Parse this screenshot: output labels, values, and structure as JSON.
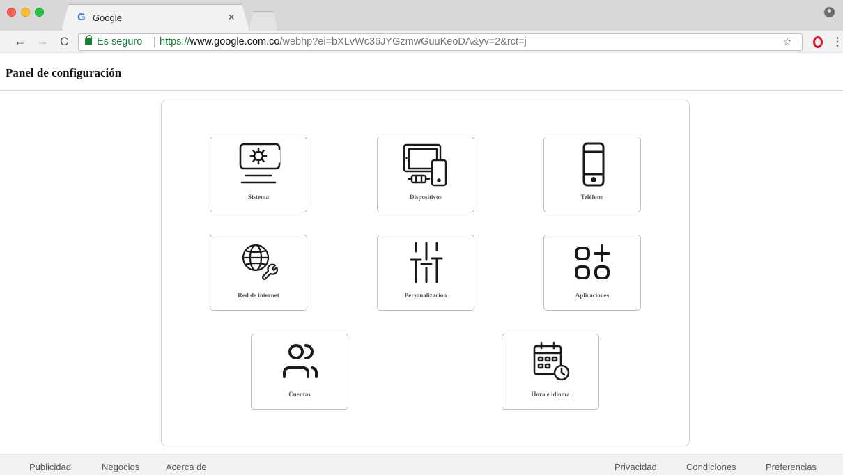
{
  "browser": {
    "tab_title": "Google",
    "tab_favicon": "G",
    "tab_close": "×",
    "secure_label": "Es seguro",
    "url_scheme": "https://",
    "url_host": "www.google.com.co",
    "url_rest": "/webhp?ei=bXLvWc36JYGzmwGuuKeoDA&yv=2&rct=j",
    "nav_back": "←",
    "nav_forward": "→",
    "nav_reload": "C",
    "bookmark_star": "☆",
    "menu": "⋮"
  },
  "page": {
    "title": "Panel de configuración"
  },
  "settings": [
    {
      "label": "Sistema",
      "icon": "monitor-gear-icon"
    },
    {
      "label": "Dispositivos",
      "icon": "devices-icon"
    },
    {
      "label": "Teléfono",
      "icon": "phone-icon"
    },
    {
      "label": "Red de internet",
      "icon": "globe-wrench-icon"
    },
    {
      "label": "Personalización",
      "icon": "sliders-icon"
    },
    {
      "label": "Aplicaciones",
      "icon": "apps-grid-icon"
    },
    {
      "label": "Cuentas",
      "icon": "users-icon"
    },
    {
      "label": "Hora e idioma",
      "icon": "calendar-clock-icon"
    }
  ],
  "footer": {
    "left": [
      "Publicidad",
      "Negocios",
      "Acerca de"
    ],
    "right": [
      "Privacidad",
      "Condiciones",
      "Preferencias"
    ]
  },
  "colors": {
    "secure_green": "#188038",
    "icon_stroke": "#1a1a1a",
    "card_border": "#bdbdbd"
  }
}
